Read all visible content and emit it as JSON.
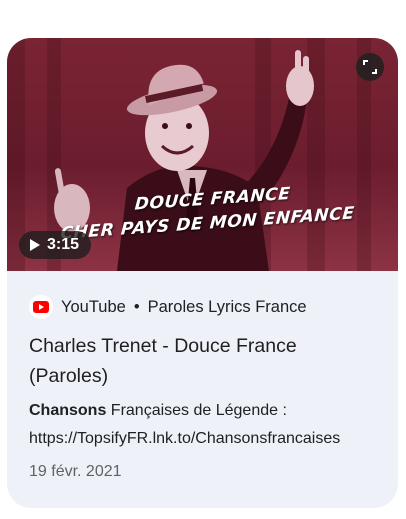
{
  "video": {
    "thumbnail_caption_line1": "DOUCE FRANCE",
    "thumbnail_caption_line2": "CHER PAYS DE MON ENFANCE",
    "duration": "3:15",
    "play_icon": "play-icon",
    "expand_icon": "expand-icon"
  },
  "source": {
    "platform": "YouTube",
    "separator": "•",
    "channel": "Paroles Lyrics France",
    "icon": "youtube-icon",
    "brand_color": "#ff0000"
  },
  "result": {
    "title": "Charles Trenet - Douce France (Paroles)",
    "snippet_bold": "Chansons",
    "snippet_rest": " Françaises de Légende :",
    "snippet_link": "https://TopsifyFR.lnk.to/Chansonsfrancaises",
    "date": "19 févr. 2021"
  },
  "colors": {
    "card_bg": "#eef2f8",
    "thumb_tint": "#7a2434"
  }
}
